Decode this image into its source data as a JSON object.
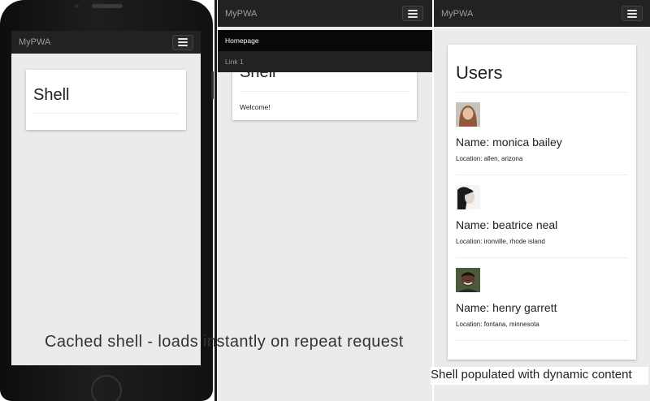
{
  "panel1": {
    "brand": "MyPWA",
    "card_title": "Shell"
  },
  "panel2": {
    "brand": "MyPWA",
    "menu": [
      {
        "label": "Homepage",
        "active": true
      },
      {
        "label": "Link 1",
        "active": false
      }
    ],
    "card_title": "Shell",
    "card_text": "Welcome!"
  },
  "panel3": {
    "brand": "MyPWA",
    "card_title": "Users",
    "users": [
      {
        "name": "Name: monica bailey",
        "location": "Location: allen, arizona",
        "avatar": "avatar-woman-1"
      },
      {
        "name": "Name: beatrice neal",
        "location": "Location: ironville, rhode island",
        "avatar": "avatar-woman-2"
      },
      {
        "name": "Name: henry garrett",
        "location": "Location: fontana, minnesota",
        "avatar": "avatar-man-1"
      }
    ]
  },
  "captions": {
    "left": "Cached shell - loads instantly on repeat request",
    "right": "Shell populated with dynamic content"
  },
  "colors": {
    "navbar": "#222222",
    "menu_active": "#080808",
    "page_bg": "#ebebeb"
  }
}
